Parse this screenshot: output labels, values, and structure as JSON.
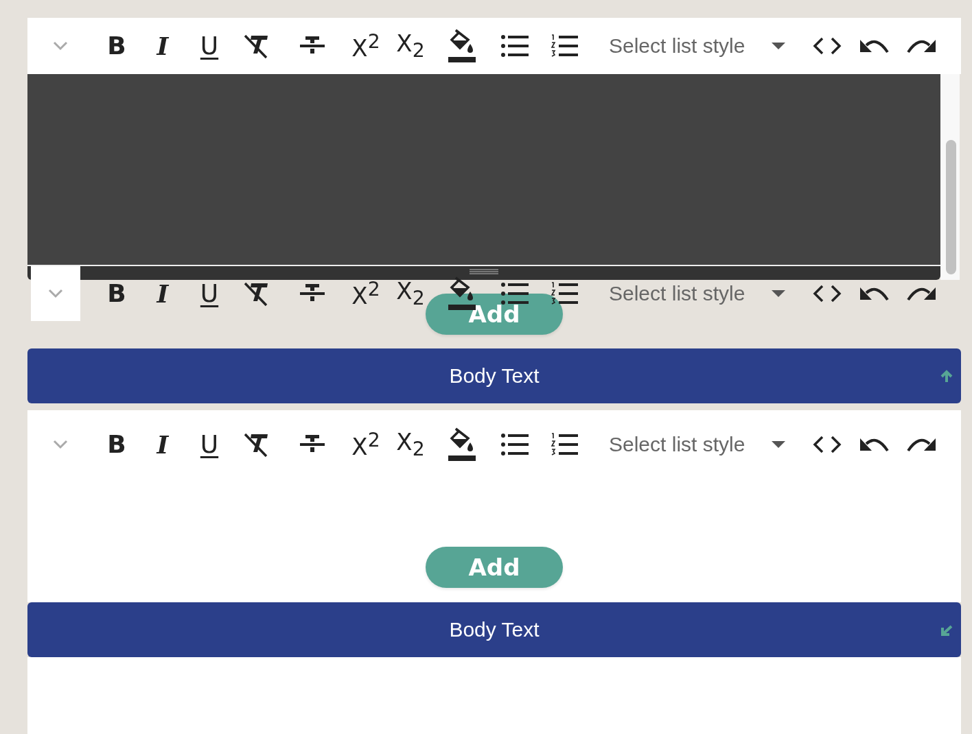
{
  "panels": [
    {
      "kind": "dark",
      "toolbars": [
        {
          "kind": "solid",
          "buttons": [
            {
              "kind": "collapse"
            },
            {
              "kind": "bold",
              "label": "B"
            },
            {
              "kind": "italic",
              "label": "I"
            },
            {
              "kind": "underline",
              "label": "U"
            },
            {
              "kind": "clear"
            },
            {
              "kind": "strike"
            },
            {
              "kind": "sup",
              "label": "X$^{2}$"
            },
            {
              "kind": "sub",
              "label": "X$_{2}$"
            },
            {
              "kind": "fill"
            },
            {
              "kind": "bullets"
            },
            {
              "kind": "numbers"
            },
            {
              "kind": "select",
              "placeholder": "Select list style"
            },
            {
              "kind": "code"
            },
            {
              "kind": "undo"
            },
            {
              "kind": "redo"
            }
          ]
        },
        {
          "kind": "ghost",
          "buttons": [
            {
              "kind": "collapse"
            },
            {
              "kind": "bold",
              "label": "B"
            },
            {
              "kind": "italic",
              "label": "I"
            },
            {
              "kind": "underline",
              "label": "U"
            },
            {
              "kind": "clear"
            },
            {
              "kind": "strike"
            },
            {
              "kind": "sup",
              "label": "X$^{2}$"
            },
            {
              "kind": "sub",
              "label": "X$_{2}$"
            },
            {
              "kind": "fill"
            },
            {
              "kind": "bullets"
            },
            {
              "kind": "numbers"
            },
            {
              "kind": "select",
              "placeholder": "Select list style"
            },
            {
              "kind": "code"
            },
            {
              "kind": "undo"
            },
            {
              "kind": "redo"
            }
          ]
        }
      ],
      "add_label": "Add",
      "header": {
        "label": "Body Text",
        "expanded": true
      }
    },
    {
      "kind": "light",
      "toolbars": [
        {
          "kind": "solid",
          "buttons": [
            {
              "kind": "collapse"
            },
            {
              "kind": "bold",
              "label": "B"
            },
            {
              "kind": "italic",
              "label": "I"
            },
            {
              "kind": "underline",
              "label": "U"
            },
            {
              "kind": "clear"
            },
            {
              "kind": "strike"
            },
            {
              "kind": "sup",
              "label": "X$^{2}$"
            },
            {
              "kind": "sub",
              "label": "X$_{2}$"
            },
            {
              "kind": "fill"
            },
            {
              "kind": "bullets"
            },
            {
              "kind": "numbers"
            },
            {
              "kind": "select",
              "placeholder": "Select list style"
            },
            {
              "kind": "code"
            },
            {
              "kind": "undo"
            },
            {
              "kind": "redo"
            }
          ]
        }
      ],
      "add_label": "Add",
      "header": {
        "label": "Body Text",
        "expanded": false
      }
    }
  ]
}
